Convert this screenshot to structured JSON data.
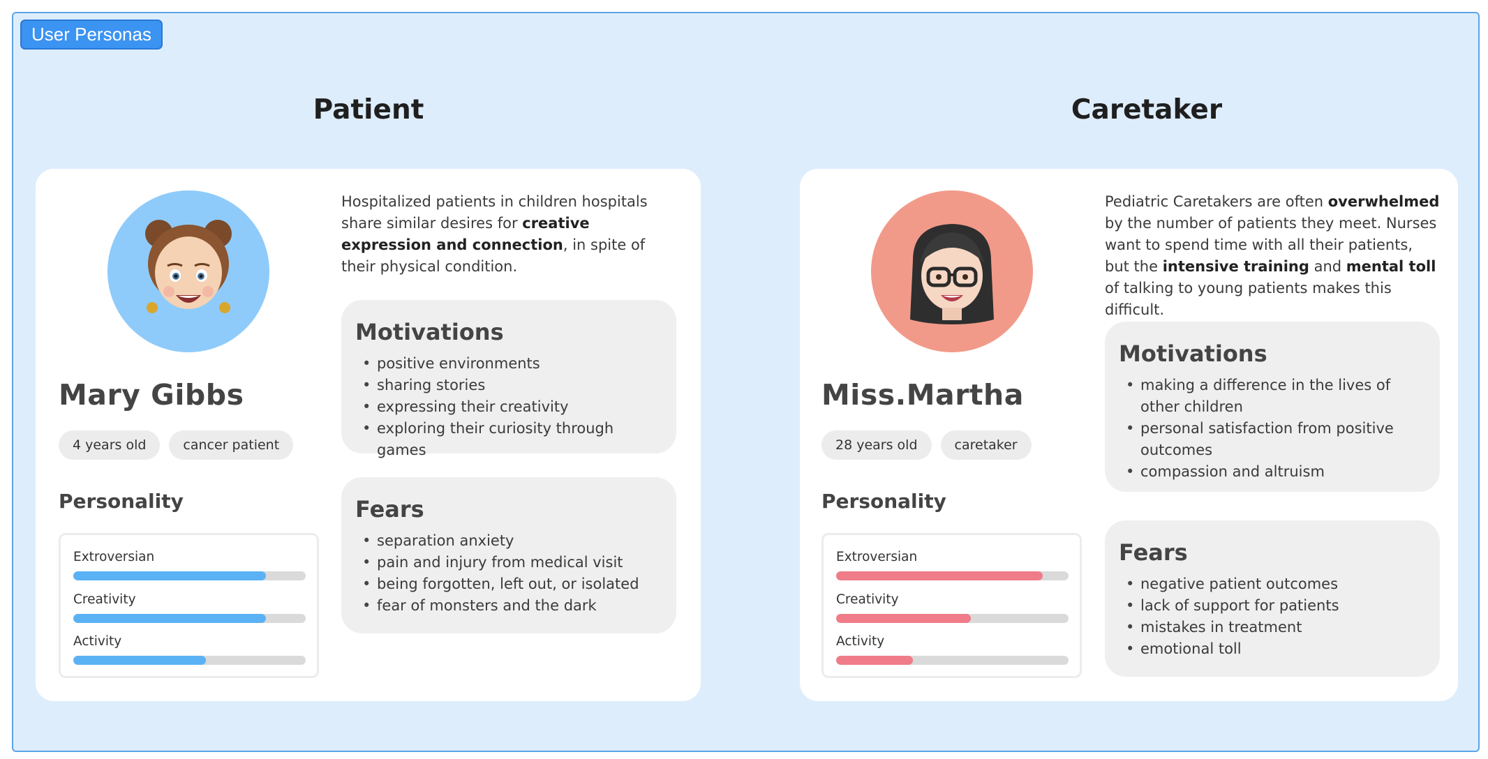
{
  "frame": {
    "label": "User Personas"
  },
  "patient": {
    "section_title": "Patient",
    "name": "Mary Gibbs",
    "chips": [
      "4 years old",
      "cancer patient"
    ],
    "personality_heading": "Personality",
    "traits": [
      {
        "label": "Extroversian",
        "value": 0.83
      },
      {
        "label": "Creativity",
        "value": 0.83
      },
      {
        "label": "Activity",
        "value": 0.57
      }
    ],
    "accent": "#5ab2f5",
    "avatar_bg": "#8ecbfa",
    "avatar_icon": "girl-memoji-icon",
    "description": [
      {
        "t": "Hospitalized patients in children hospitals share similar desires for "
      },
      {
        "t": "creative expression and connection",
        "b": true
      },
      {
        "t": ", in spite of their physical condition."
      }
    ],
    "motivations_title": "Motivations",
    "motivations": [
      "positive environments",
      "sharing stories",
      "expressing their creativity",
      "exploring their curiosity through games"
    ],
    "fears_title": "Fears",
    "fears": [
      "separation anxiety",
      "pain and injury from medical visit",
      "being forgotten, left out, or isolated",
      "fear of monsters and the dark"
    ]
  },
  "caretaker": {
    "section_title": "Caretaker",
    "name": "Miss.Martha",
    "chips": [
      "28 years old",
      "caretaker"
    ],
    "personality_heading": "Personality",
    "traits": [
      {
        "label": "Extroversian",
        "value": 0.89
      },
      {
        "label": "Creativity",
        "value": 0.58
      },
      {
        "label": "Activity",
        "value": 0.33
      }
    ],
    "accent": "#ef7c88",
    "avatar_bg": "#f29a8a",
    "avatar_icon": "woman-with-glasses-memoji-icon",
    "description": [
      {
        "t": "Pediatric Caretakers are often "
      },
      {
        "t": "overwhelmed",
        "b": true
      },
      {
        "t": " by the number of patients they meet. Nurses want to spend time with all their patients, but the "
      },
      {
        "t": "intensive training",
        "b": true
      },
      {
        "t": " and "
      },
      {
        "t": "mental toll",
        "b": true
      },
      {
        "t": " of talking to young patients makes this difficult."
      }
    ],
    "motivations_title": "Motivations",
    "motivations": [
      "making a difference in the lives of other children",
      "personal satisfaction from positive outcomes",
      "compassion and altruism"
    ],
    "fears_title": "Fears",
    "fears": [
      "negative patient outcomes",
      "lack of support for patients",
      "mistakes in treatment",
      "emotional toll"
    ]
  }
}
